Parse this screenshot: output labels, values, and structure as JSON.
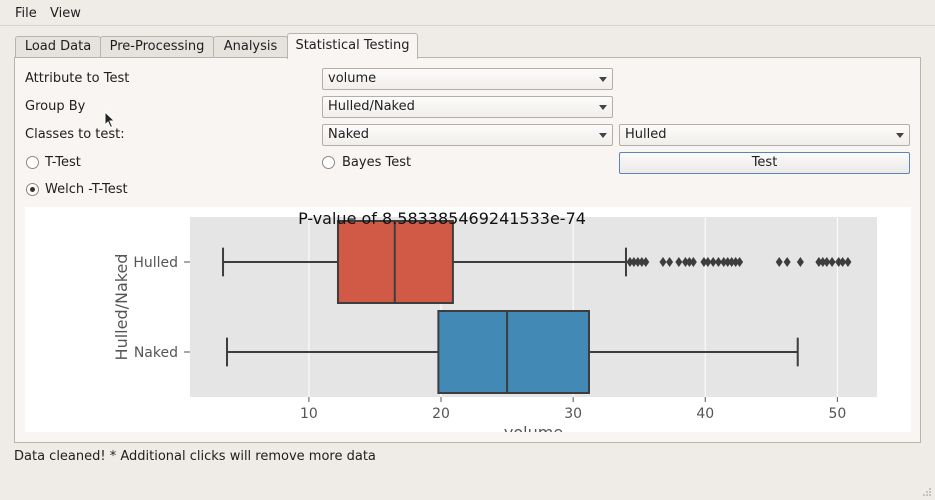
{
  "menu": {
    "file": "File",
    "view": "View"
  },
  "tabs": [
    {
      "label": "Load Data"
    },
    {
      "label": "Pre-Processing"
    },
    {
      "label": "Analysis"
    },
    {
      "label": "Statistical Testing"
    }
  ],
  "form": {
    "attribute_label": "Attribute to Test",
    "attribute_value": "volume",
    "group_label": "Group By",
    "group_value": "Hulled/Naked",
    "classes_label": "Classes to test:",
    "class_a": "Naked",
    "class_b": "Hulled",
    "ttest_label": "T-Test",
    "bayes_label": "Bayes Test",
    "test_button": "Test",
    "welch_label": "Welch -T-Test",
    "selected_test": "Welch -T-Test"
  },
  "chart_data": {
    "type": "boxplot",
    "orientation": "horizontal",
    "title": "P-value of 8.583385469241533e-74",
    "xlabel": "volume",
    "ylabel": "Hulled/Naked",
    "xlim": [
      1.0,
      53.0
    ],
    "xticks": [
      10,
      20,
      30,
      40,
      50
    ],
    "grid": true,
    "background": "#e5e5e5",
    "series": [
      {
        "name": "Hulled",
        "color": "#d15a47",
        "whisker_low": 3.5,
        "q1": 12.2,
        "median": 16.5,
        "q3": 20.9,
        "whisker_high": 34.0,
        "outliers": [
          34.3,
          34.6,
          34.9,
          35.2,
          35.5,
          36.8,
          37.3,
          38.0,
          38.5,
          38.8,
          39.1,
          39.9,
          40.2,
          40.6,
          41.0,
          41.4,
          41.7,
          42.0,
          42.3,
          42.6,
          45.6,
          46.2,
          47.2,
          48.6,
          48.9,
          49.2,
          49.6,
          50.1,
          50.4,
          50.8
        ]
      },
      {
        "name": "Naked",
        "color": "#4389b5",
        "whisker_low": 3.8,
        "q1": 19.8,
        "median": 25.0,
        "q3": 31.2,
        "whisker_high": 47.0,
        "outliers": []
      }
    ]
  },
  "status": "Data cleaned! * Additional clicks will remove more data"
}
